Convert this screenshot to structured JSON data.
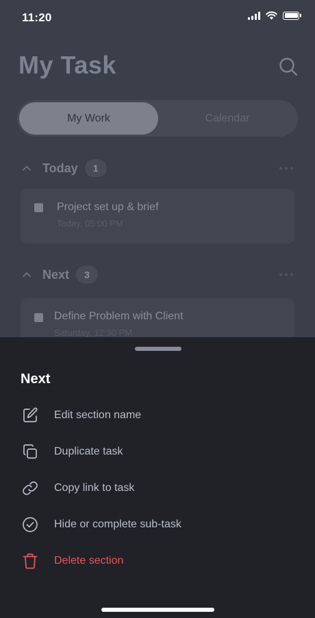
{
  "status_bar": {
    "time": "11:20"
  },
  "header": {
    "title": "My Task"
  },
  "tabs": [
    {
      "label": "My Work",
      "active": true
    },
    {
      "label": "Calendar",
      "active": false
    }
  ],
  "sections": [
    {
      "title": "Today",
      "count": "1",
      "tasks": [
        {
          "title": "Project set up & brief",
          "time": "Today, 05:00 PM"
        }
      ]
    },
    {
      "title": "Next",
      "count": "3",
      "tasks": [
        {
          "title": "Define Problem with Client",
          "time": "Saturday, 12:30 PM"
        }
      ]
    }
  ],
  "sheet": {
    "title": "Next",
    "items": [
      {
        "label": "Edit section name",
        "icon": "edit-icon"
      },
      {
        "label": "Duplicate task",
        "icon": "duplicate-icon"
      },
      {
        "label": "Copy link to task",
        "icon": "link-icon"
      },
      {
        "label": "Hide or complete sub-task",
        "icon": "check-circle-icon"
      },
      {
        "label": "Delete section",
        "icon": "trash-icon",
        "danger": true
      }
    ]
  },
  "colors": {
    "background": "#3a3f4a",
    "sheet": "#202228",
    "danger": "#e8555a",
    "accent_active_tab": "#7d818b"
  }
}
